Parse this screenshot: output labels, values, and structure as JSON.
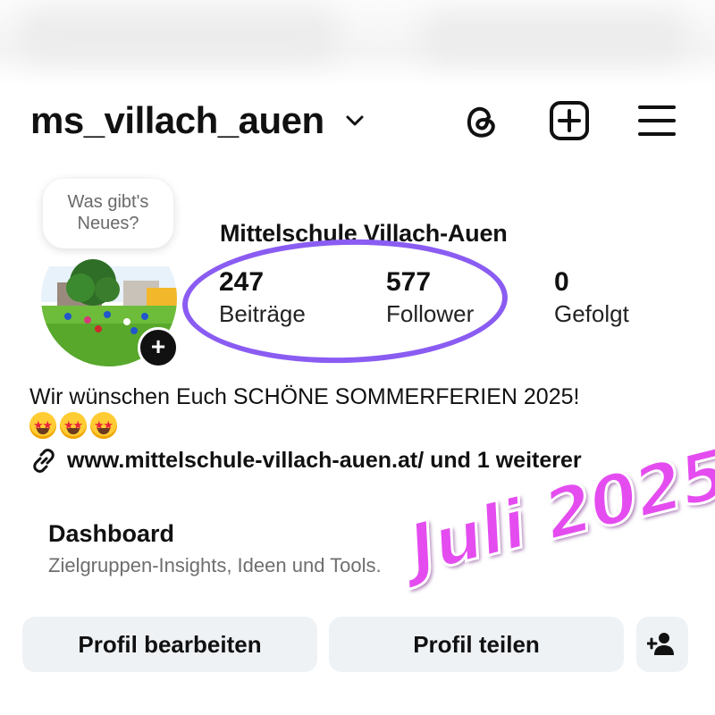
{
  "header": {
    "username": "ms_villach_auen",
    "icons": [
      "chevron-down-icon",
      "threads-icon",
      "add-post-icon",
      "menu-icon"
    ]
  },
  "note": {
    "text": "Was gibt's Neues?"
  },
  "profile": {
    "display_name": "Mittelschule Villach-Auen",
    "stats": [
      {
        "value": "247",
        "label": "Beiträge"
      },
      {
        "value": "577",
        "label": "Follower"
      },
      {
        "value": "0",
        "label": "Gefolgt"
      }
    ],
    "highlight_color": "#8a5cf2"
  },
  "bio": {
    "text": "Wir wünschen Euch SCHÖNE SOMMERFERIEN 2025!",
    "emojis": [
      "star-struck-emoji",
      "star-struck-emoji",
      "star-struck-emoji"
    ],
    "link": "www.mittelschule-villach-auen.at/ und 1 weiterer"
  },
  "dashboard": {
    "title": "Dashboard",
    "subtitle": "Zielgruppen-Insights, Ideen und Tools."
  },
  "overlay": {
    "text": "Juli 2025",
    "color": "#e44cf0"
  },
  "actions": {
    "edit_profile": "Profil bearbeiten",
    "share_profile": "Profil teilen",
    "add_person_icon": "add-person-icon"
  }
}
